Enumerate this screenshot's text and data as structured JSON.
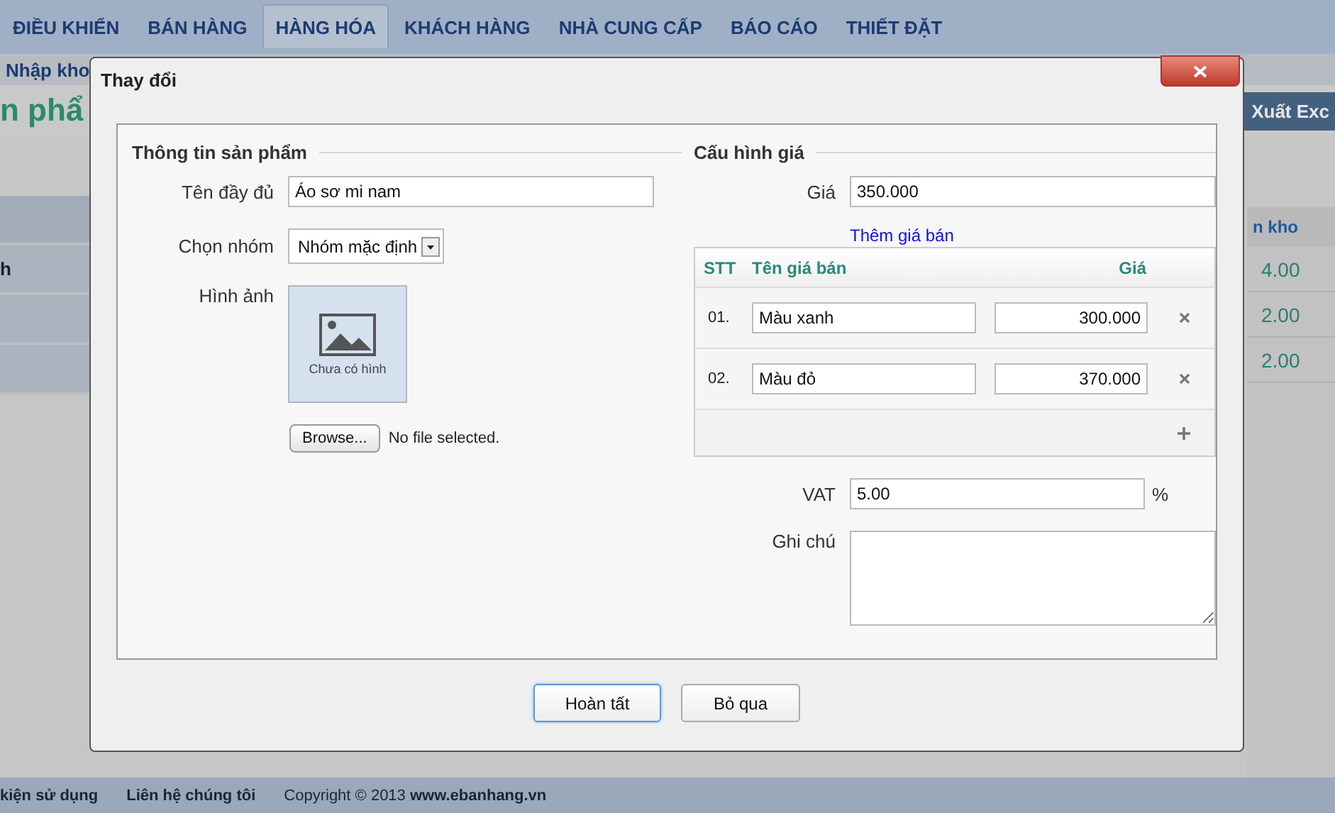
{
  "nav": {
    "tabs": [
      {
        "label": "ĐIỀU KHIỂN",
        "selected": false
      },
      {
        "label": "BÁN HÀNG",
        "selected": false
      },
      {
        "label": "HÀNG HÓA",
        "selected": true
      },
      {
        "label": "KHÁCH HÀNG",
        "selected": false
      },
      {
        "label": "NHÀ CUNG CẤP",
        "selected": false
      },
      {
        "label": "BÁO CÁO",
        "selected": false
      },
      {
        "label": "THIẾT ĐẶT",
        "selected": false
      }
    ]
  },
  "breadcrumb": "Nhập kho",
  "page_title": "n phẩ",
  "export_button": "Xuất Exc",
  "sidebar": {
    "item": "h"
  },
  "stock_table": {
    "header": "n kho",
    "rows": [
      "4.00",
      "2.00",
      "2.00"
    ]
  },
  "dialog": {
    "title": "Thay đổi",
    "product_info": {
      "heading": "Thông tin sản phẩm",
      "name": {
        "label": "Tên đầy đủ",
        "value": "Áo sơ mi nam"
      },
      "group": {
        "label": "Chọn nhóm",
        "value": "Nhóm mặc định"
      },
      "image": {
        "label": "Hình ảnh",
        "caption": "Chưa có hình",
        "browse_button": "Browse...",
        "file_status": "No file selected."
      }
    },
    "pricing": {
      "heading": "Cấu hình giá",
      "price": {
        "label": "Giá",
        "value": "350.000"
      },
      "add_price_link": "Thêm giá bán",
      "table": {
        "columns": [
          "STT",
          "Tên giá bán",
          "Giá"
        ],
        "rows": [
          {
            "index": "01.",
            "name": "Màu xanh",
            "price": "300.000"
          },
          {
            "index": "02.",
            "name": "Màu đỏ",
            "price": "370.000"
          }
        ]
      },
      "vat": {
        "label": "VAT",
        "value": "5.00",
        "unit": "%"
      },
      "note": {
        "label": "Ghi chú"
      }
    },
    "buttons": [
      {
        "label": "Hoàn tất",
        "focused": true
      },
      {
        "label": "Bỏ qua",
        "focused": false
      }
    ]
  },
  "footer": {
    "links": [
      "kiện sử dụng",
      "Liên hệ chúng tôi"
    ],
    "copyright": "Copyright © 2013 **www.ebanhang.vn**"
  }
}
